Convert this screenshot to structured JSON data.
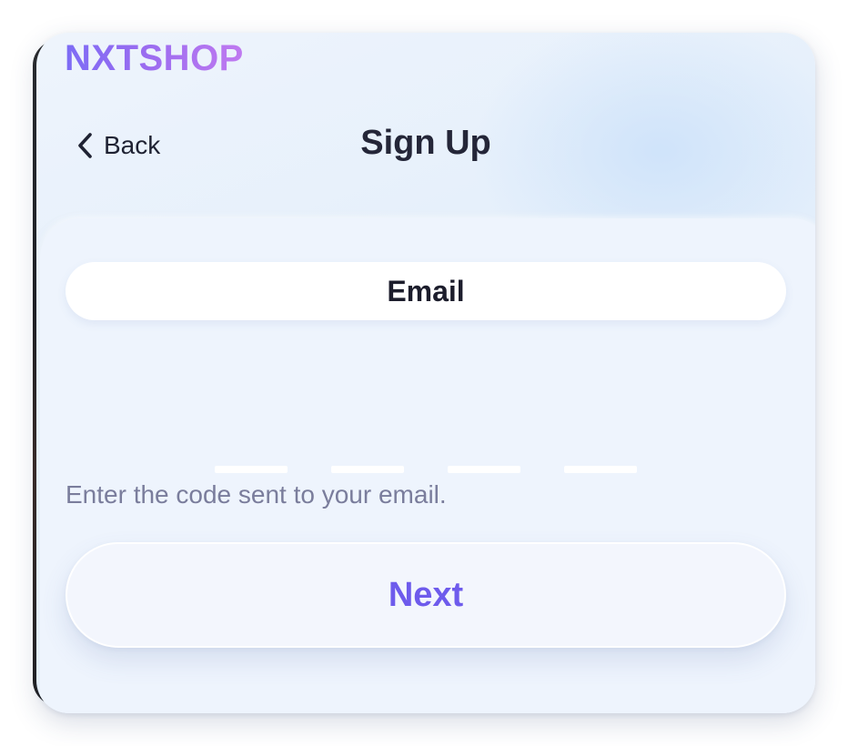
{
  "brand": {
    "logo_text": "NXTSHOP"
  },
  "header": {
    "back_label": "Back",
    "title": "Sign Up"
  },
  "form": {
    "method_label": "Email",
    "code_slots": [
      "",
      "",
      "",
      ""
    ],
    "hint": "Enter the code sent to your email.",
    "next_label": "Next"
  },
  "icons": {
    "back": "chevron-left-icon"
  },
  "colors": {
    "accent": "#6e5bec",
    "logo_gradient_start": "#7d6cf5",
    "logo_gradient_end": "#c07af0",
    "title_text": "#242638",
    "hint_text": "#7a7d9c",
    "background": "#e6f0fb"
  }
}
